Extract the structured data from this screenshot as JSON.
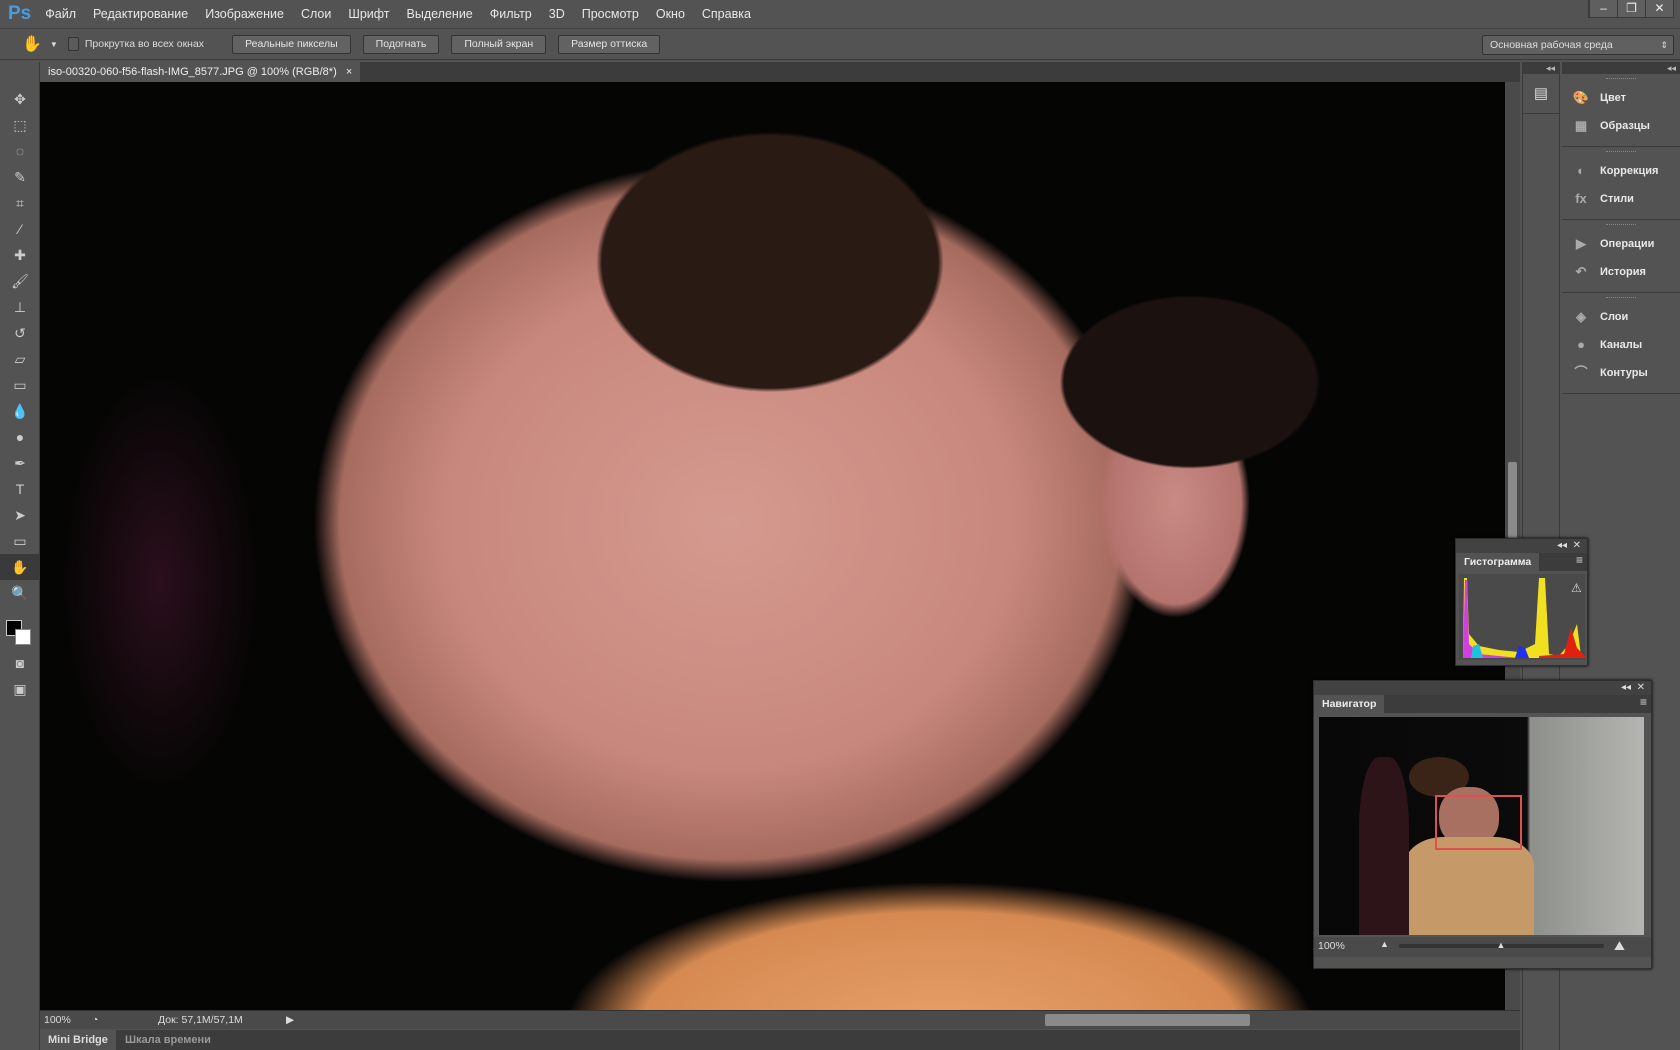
{
  "app": {
    "logo": "Ps"
  },
  "menu": [
    "Файл",
    "Редактирование",
    "Изображение",
    "Слои",
    "Шрифт",
    "Выделение",
    "Фильтр",
    "3D",
    "Просмотр",
    "Окно",
    "Справка"
  ],
  "window_buttons": {
    "minimize": "–",
    "restore": "❐",
    "close": "✕"
  },
  "options": {
    "scroll_all_label": "Прокрутка во всех окнах",
    "actual_pixels": "Реальные пикселы",
    "fit": "Подогнать",
    "full_screen": "Полный экран",
    "print_size": "Размер оттиска",
    "workspace": "Основная рабочая среда"
  },
  "document": {
    "tab_title": "iso-00320-060-f56-flash-IMG_8577.JPG @ 100% (RGB/8*)",
    "close": "×"
  },
  "status": {
    "zoom": "100%",
    "doc_info": "Док: 57,1M/57,1M"
  },
  "bottom_tabs": [
    "Mini Bridge",
    "Шкала времени"
  ],
  "panels": {
    "groups": [
      [
        "Цвет",
        "Образцы"
      ],
      [
        "Коррекция",
        "Стили"
      ],
      [
        "Операции",
        "История"
      ],
      [
        "Слои",
        "Каналы",
        "Контуры"
      ]
    ]
  },
  "histogram": {
    "title": "Гистограмма",
    "warning": "⚠"
  },
  "navigator": {
    "title": "Навигатор",
    "zoom": "100%",
    "zoom_fraction": 0.5
  },
  "colors": {
    "accent": "#4a9be0",
    "nav_box": "#e05050"
  }
}
